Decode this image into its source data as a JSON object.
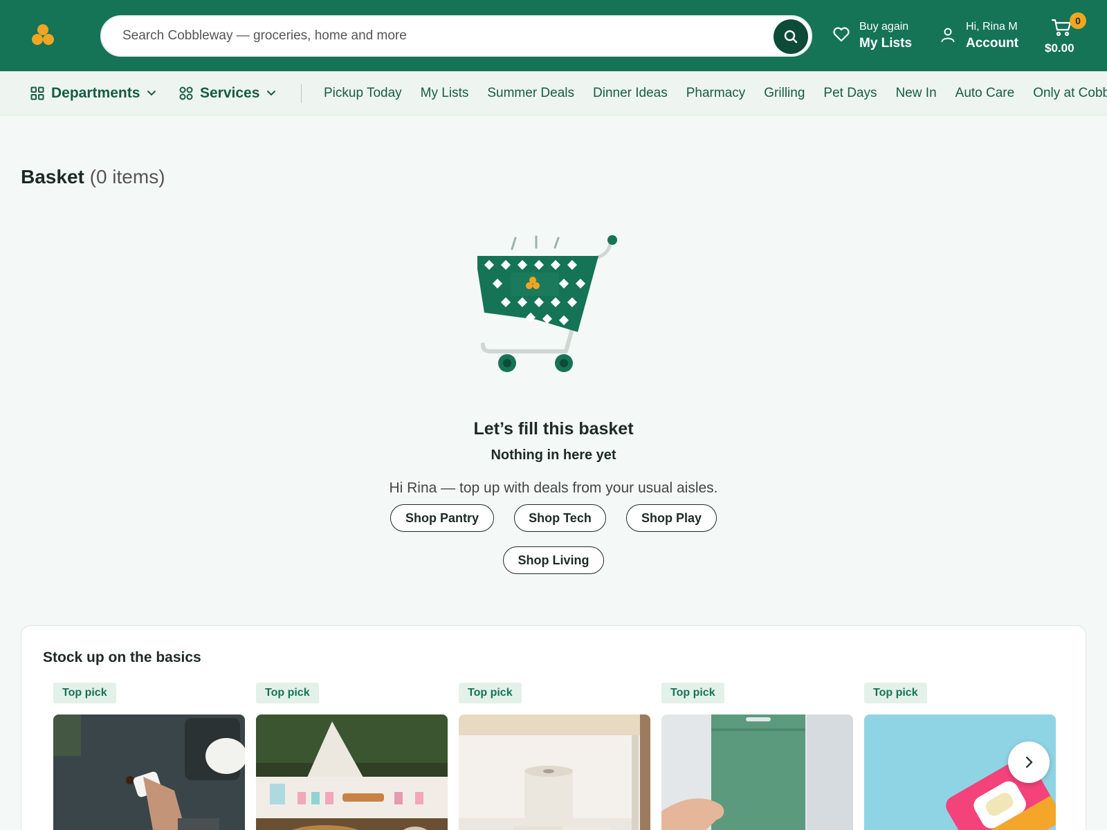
{
  "header": {
    "search_placeholder": "Search Cobbleway — groceries, home and more",
    "lists_small": "Buy again",
    "lists_big": "My Lists",
    "account_small": "Hi, Rina M",
    "account_big": "Account",
    "cart_count": "0",
    "cart_total": "$0.00"
  },
  "nav": {
    "departments": "Departments",
    "services": "Services",
    "links": [
      "Pickup Today",
      "My Lists",
      "Summer Deals",
      "Dinner Ideas",
      "Pharmacy",
      "Grilling",
      "Pet Days",
      "New In",
      "Auto Care",
      "Only at Cobbleway"
    ]
  },
  "basket": {
    "title": "Basket",
    "count": "(0 items)",
    "empty_title": "Let’s fill this basket",
    "empty_sub": "Nothing in here yet",
    "empty_msg": "Hi Rina — top up with deals from your usual aisles.",
    "buttons": [
      "Shop Pantry",
      "Shop Tech",
      "Shop Play",
      "Shop Living"
    ]
  },
  "basics": {
    "title": "Stock up on the basics",
    "badge": "Top pick",
    "items": [
      "paper-towel-wipe",
      "picnic-party-table",
      "toilet-paper-rolls",
      "green-resealable-pouch",
      "wet-wipes-pack"
    ]
  },
  "colors": {
    "brand_green": "#157356",
    "accent_orange": "#f0a623",
    "dark_green": "#0d4a37"
  }
}
